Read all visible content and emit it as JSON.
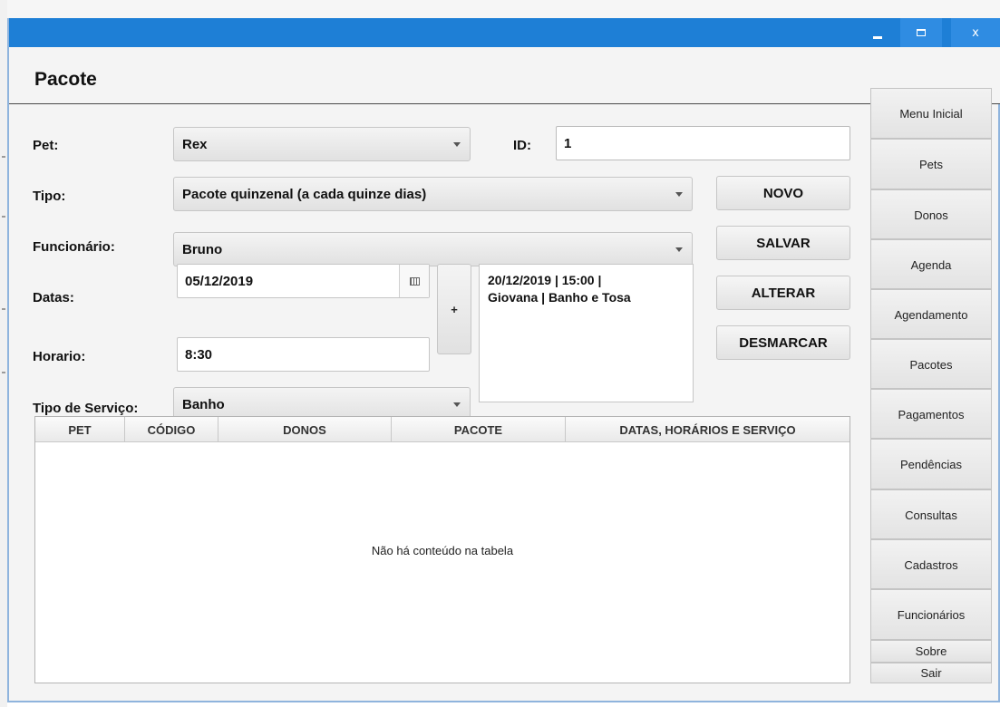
{
  "window": {
    "title": "",
    "controls": {
      "minimize": "minimize-icon",
      "maximize": "maximize-icon",
      "close": "x"
    }
  },
  "header": {
    "title": "Pacote"
  },
  "form": {
    "pet": {
      "label": "Pet:",
      "value": "Rex"
    },
    "id": {
      "label": "ID:",
      "value": "1"
    },
    "tipo": {
      "label": "Tipo:",
      "value": "Pacote quinzenal (a cada quinze dias)"
    },
    "funcionario": {
      "label": "Funcionário:",
      "value": "Bruno"
    },
    "datas": {
      "label": "Datas:",
      "value": "05/12/2019"
    },
    "horario": {
      "label": "Horario:",
      "value": "8:30"
    },
    "tipo_servico": {
      "label": "Tipo de Serviço:",
      "value": "Banho"
    },
    "add_button": "+",
    "scheduled_dates": [
      "20/12/2019 | 15:00 |",
      "Giovana | Banho e Tosa"
    ]
  },
  "actions": {
    "novo": "NOVO",
    "salvar": "SALVAR",
    "alterar": "ALTERAR",
    "desmarcar": "DESMARCAR"
  },
  "table": {
    "columns": [
      "PET",
      "CÓDIGO",
      "DONOS",
      "PACOTE",
      "DATAS, HORÁRIOS E SERVIÇO"
    ],
    "rows": [],
    "empty_message": "Não há conteúdo na tabela"
  },
  "sidebar": {
    "items": [
      "Menu Inicial",
      "Pets",
      "Donos",
      "Agenda",
      "Agendamento",
      "Pacotes",
      "Pagamentos",
      "Pendências",
      "Consultas",
      "Cadastros",
      "Funcionários",
      "Sobre",
      "Sair"
    ]
  },
  "colors": {
    "titlebar": "#1e7fd6",
    "window_border": "#8fb4dd",
    "background": "#f4f4f4"
  }
}
